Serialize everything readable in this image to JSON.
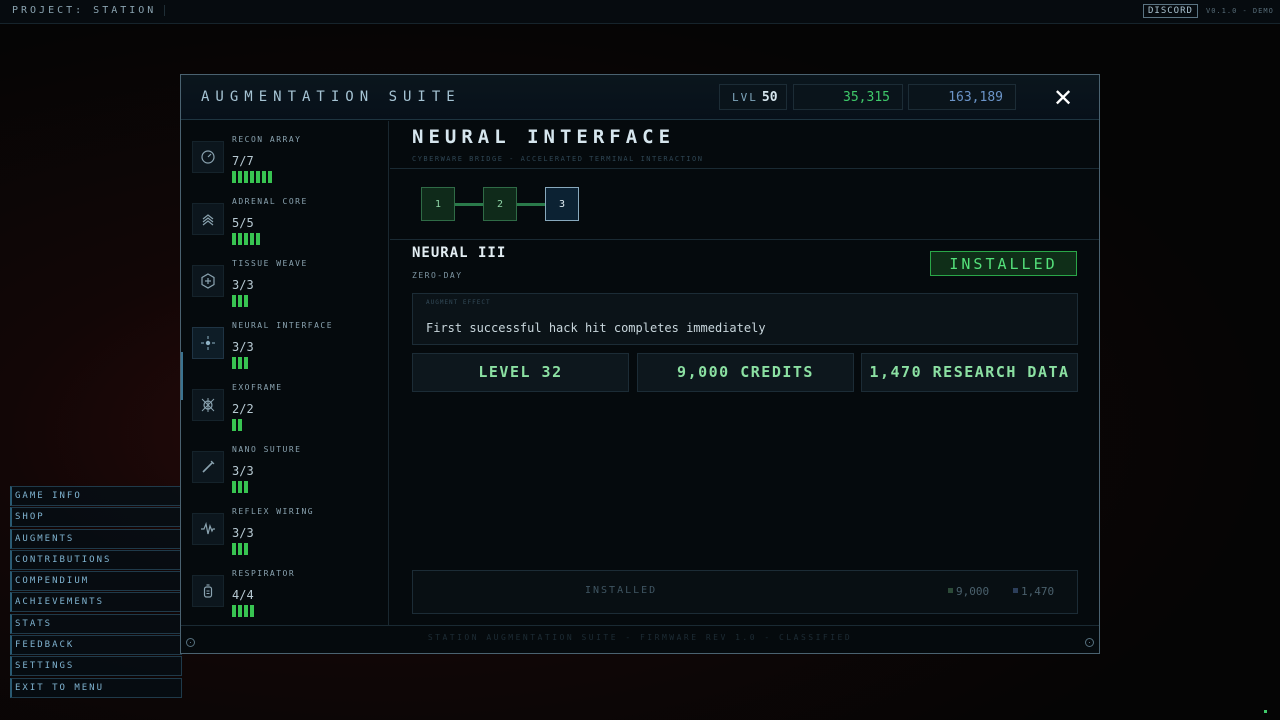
{
  "topbar": {
    "title": "PROJECT: STATION",
    "discord": "DISCORD",
    "version": "V0.1.0 - DEMO"
  },
  "sidemenu": {
    "items": [
      {
        "label": "GAME INFO"
      },
      {
        "label": "SHOP"
      },
      {
        "label": "AUGMENTS"
      },
      {
        "label": "CONTRIBUTIONS"
      },
      {
        "label": "COMPENDIUM"
      },
      {
        "label": "ACHIEVEMENTS"
      },
      {
        "label": "STATS"
      },
      {
        "label": "FEEDBACK"
      },
      {
        "label": "SETTINGS"
      },
      {
        "label": "EXIT TO MENU"
      }
    ]
  },
  "modal": {
    "title": "AUGMENTATION SUITE",
    "level_label": "LVL",
    "level_value": "50",
    "credits": "35,315",
    "research": "163,189",
    "close": "✕",
    "footer": "STATION AUGMENTATION SUITE - FIRMWARE REV 1.0 - CLASSIFIED"
  },
  "augments": [
    {
      "name": "RECON ARRAY",
      "count": "7/7",
      "pips": 7,
      "icon": "recon-icon"
    },
    {
      "name": "ADRENAL CORE",
      "count": "5/5",
      "pips": 5,
      "icon": "adrenal-icon"
    },
    {
      "name": "TISSUE WEAVE",
      "count": "3/3",
      "pips": 3,
      "icon": "tissue-icon"
    },
    {
      "name": "NEURAL INTERFACE",
      "count": "3/3",
      "pips": 3,
      "icon": "neural-icon"
    },
    {
      "name": "EXOFRAME",
      "count": "2/2",
      "pips": 2,
      "icon": "exoframe-icon"
    },
    {
      "name": "NANO SUTURE",
      "count": "3/3",
      "pips": 3,
      "icon": "suture-icon"
    },
    {
      "name": "REFLEX WIRING",
      "count": "3/3",
      "pips": 3,
      "icon": "reflex-icon"
    },
    {
      "name": "RESPIRATOR",
      "count": "4/4",
      "pips": 4,
      "icon": "respirator-icon"
    }
  ],
  "detail": {
    "title": "NEURAL INTERFACE",
    "subtitle": "CYBERWARE BRIDGE - ACCELERATED TERMINAL INTERACTION",
    "tiers": [
      "1",
      "2",
      "3"
    ],
    "selected_tier": "3",
    "tier_name": "NEURAL III",
    "tier_sub": "ZERO-DAY",
    "status": "INSTALLED",
    "effect_label": "AUGMENT EFFECT",
    "effect_text": "First successful hack hit completes immediately",
    "requirements": [
      "LEVEL 32",
      "9,000 CREDITS",
      "1,470 RESEARCH DATA"
    ],
    "install_label": "INSTALLED",
    "cost_credits": "9,000",
    "cost_research": "1,470"
  },
  "colors": {
    "accent_green": "#38c451",
    "research_blue": "#6b94c8",
    "panel_border": "#4a6270"
  }
}
